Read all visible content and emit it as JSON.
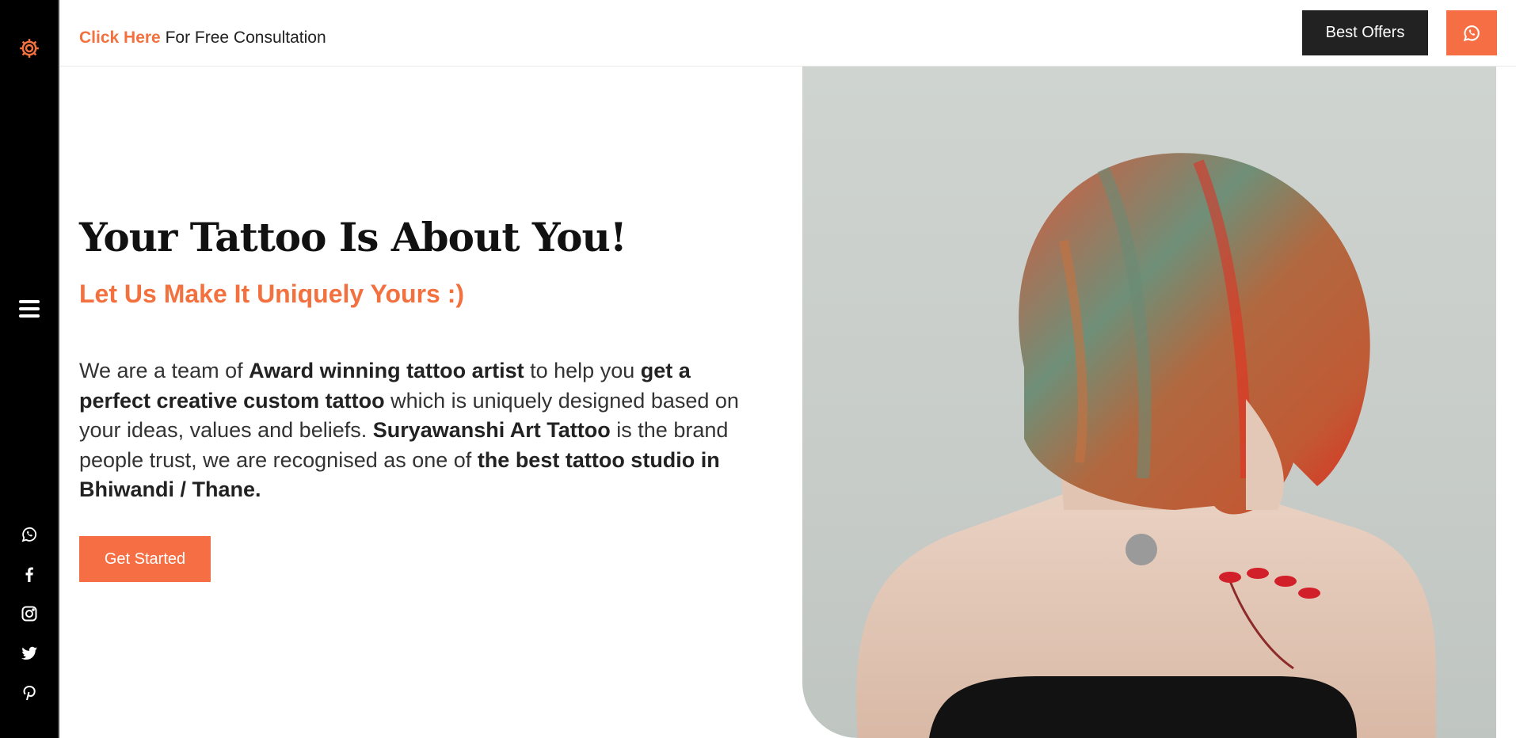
{
  "topbar": {
    "consult_link": "Click Here",
    "consult_text": " For Free Consultation",
    "offers_label": "Best Offers"
  },
  "hero": {
    "title": "Your Tattoo Is About You!",
    "subtitle": "Let Us Make It Uniquely Yours :)",
    "desc": [
      "We are a team of ",
      "Award winning tattoo artist",
      " to help you ",
      "get a perfect creative custom tattoo",
      " which is uniquely designed based on your ideas, values and beliefs. ",
      "Suryawanshi Art Tattoo",
      " is the brand people trust, we are recognised as one of ",
      "the best tattoo studio in Bhiwandi / Thane."
    ],
    "cta_label": "Get Started"
  },
  "colors": {
    "accent": "#f3703f",
    "accent_button": "#f66f44",
    "sidebar_bg": "#000000",
    "dark_button": "#222222"
  },
  "icons": {
    "sidebar_top": "gear-icon",
    "sidebar_menu": "hamburger-menu-icon",
    "social": [
      "whatsapp-icon",
      "facebook-icon",
      "instagram-icon",
      "twitter-icon",
      "pinterest-icon"
    ],
    "topbar_button": "whatsapp-icon"
  }
}
